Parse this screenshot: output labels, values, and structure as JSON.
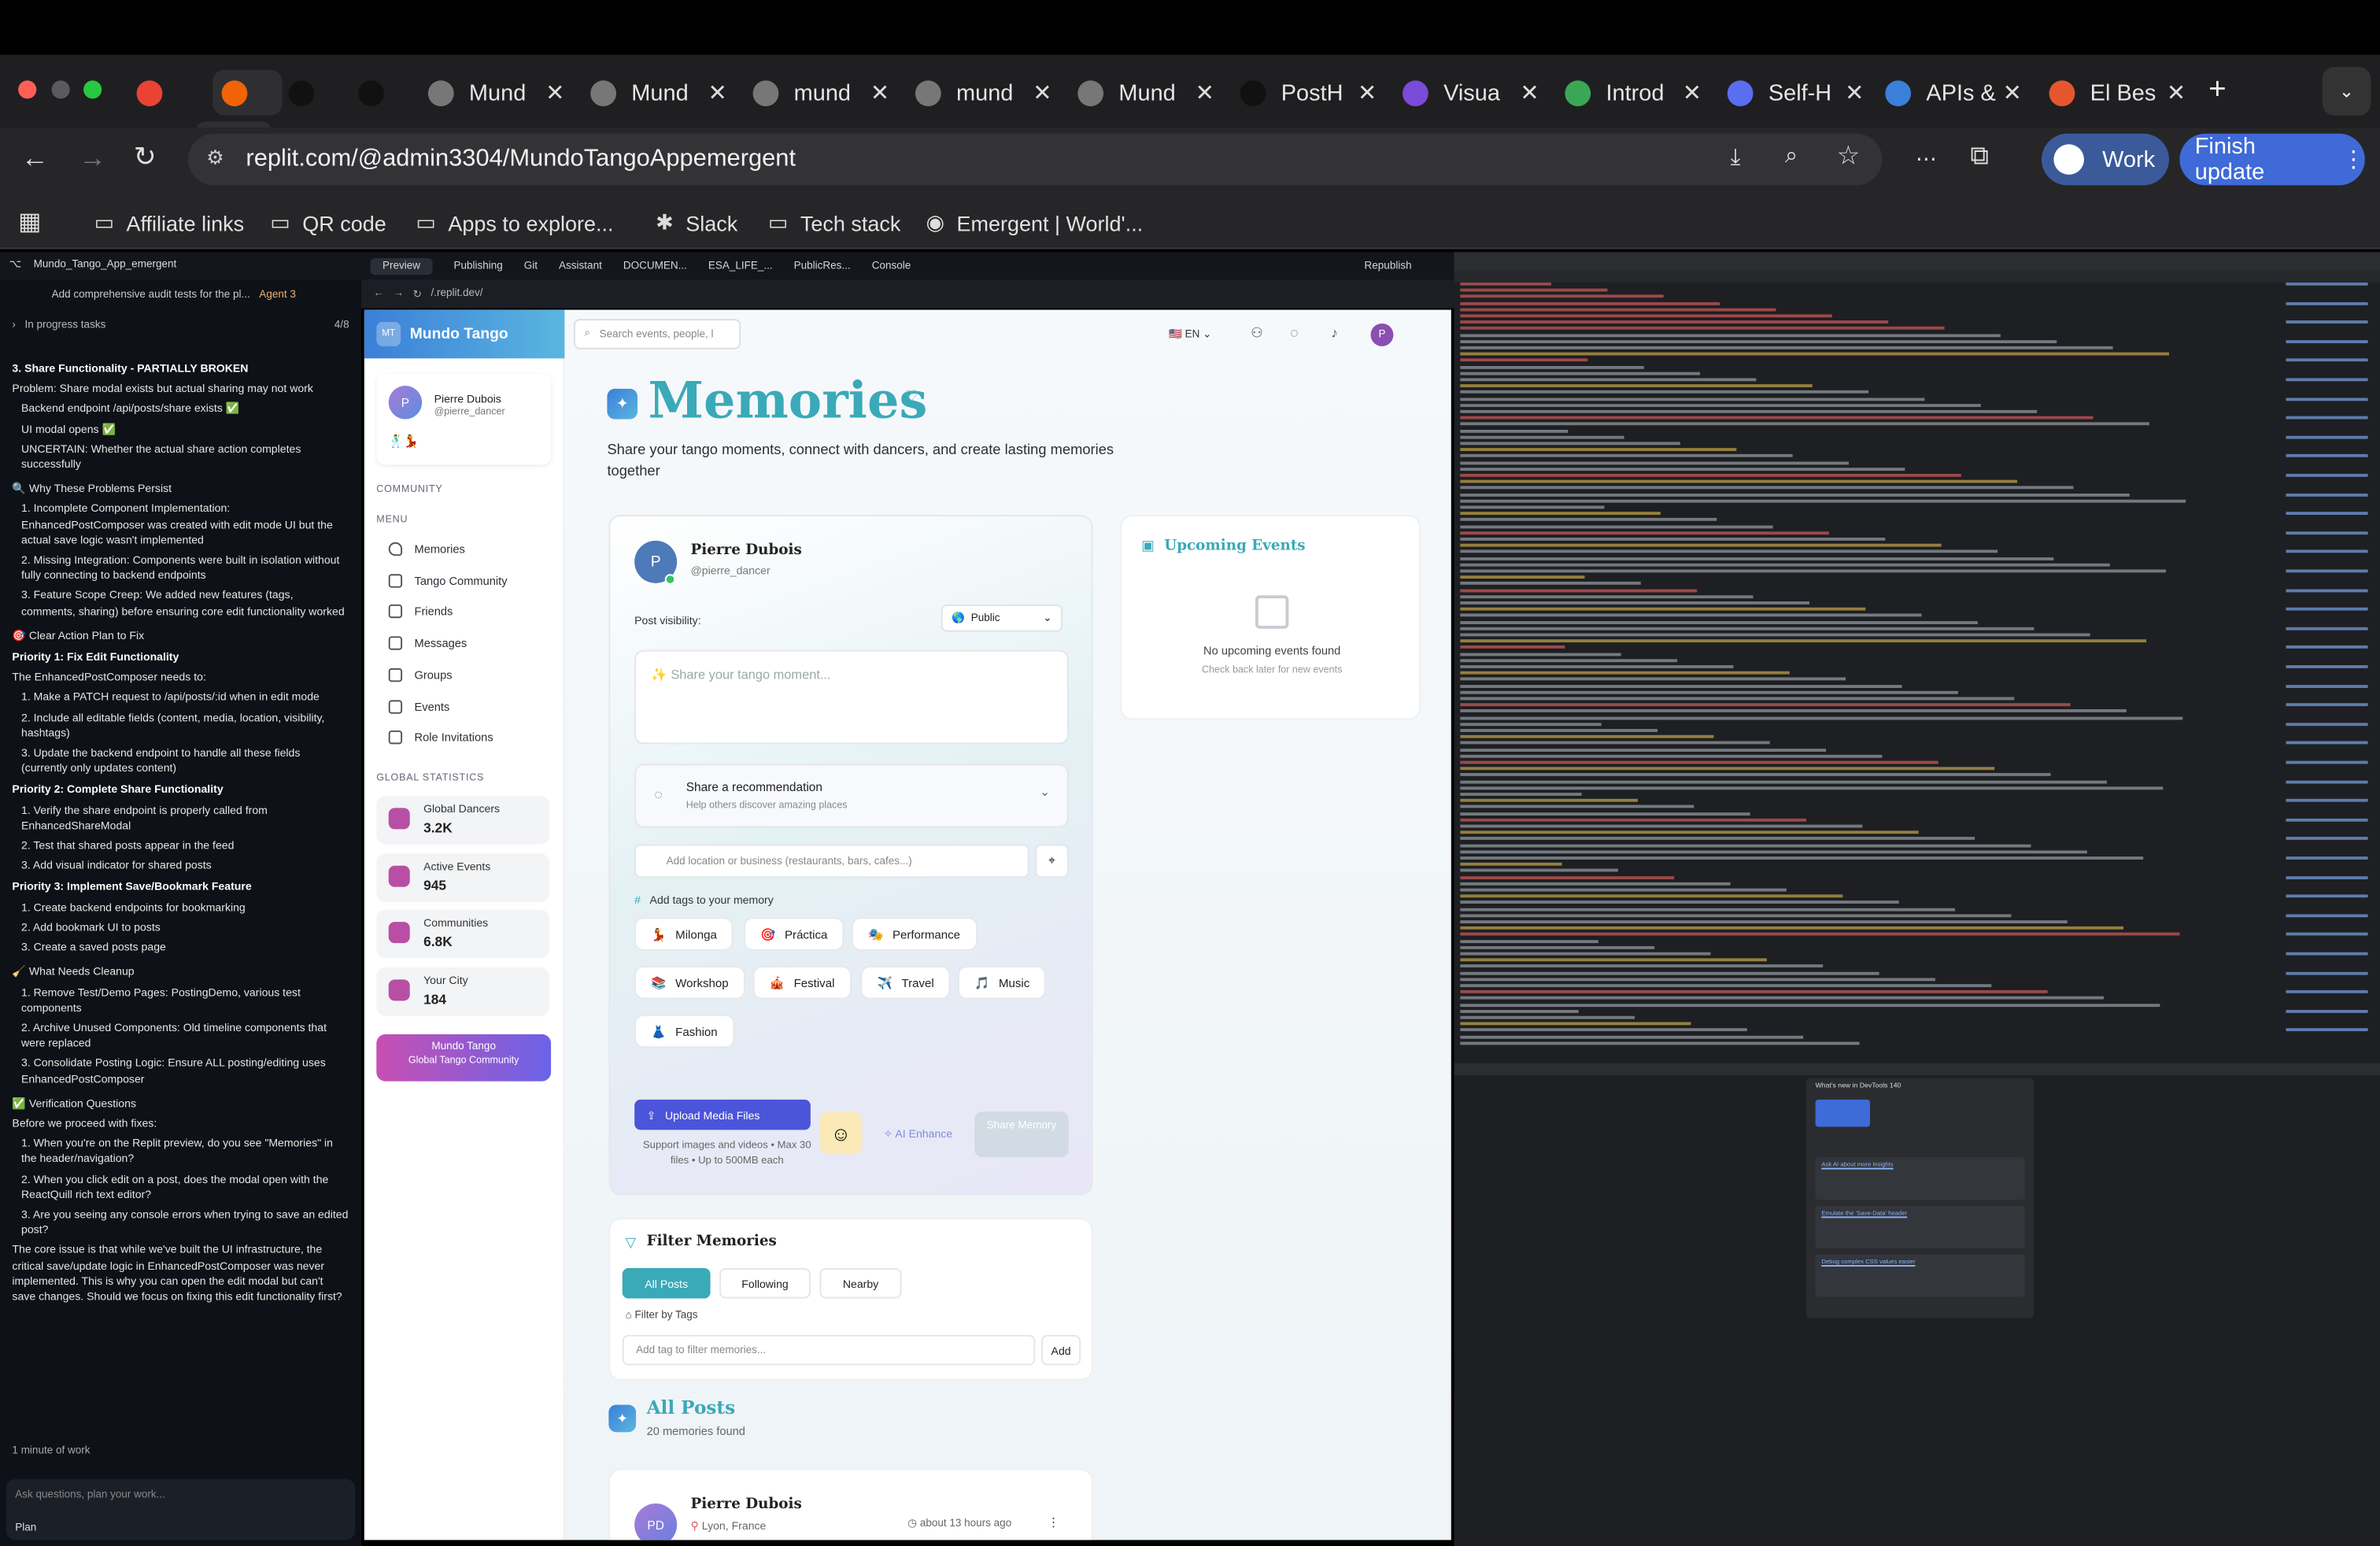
{
  "browser": {
    "tabs": [
      {
        "label": "",
        "icon": "gmail-icon"
      },
      {
        "label": "",
        "icon": "replit-icon"
      },
      {
        "label": "",
        "icon": "emergent-icon"
      },
      {
        "label": "",
        "icon": "github-icon"
      },
      {
        "label": "Mund",
        "icon": "globe-icon"
      },
      {
        "label": "Mund",
        "icon": "globe-icon"
      },
      {
        "label": "mund",
        "icon": "globe-icon"
      },
      {
        "label": "mund",
        "icon": "globe-icon"
      },
      {
        "label": "Mund",
        "icon": "globe-icon"
      },
      {
        "label": "PostH",
        "icon": "posthog-icon"
      },
      {
        "label": "Visua",
        "icon": "visual-icon"
      },
      {
        "label": "Introd",
        "icon": "chrome-icon"
      },
      {
        "label": "Self-H",
        "icon": "play-icon"
      },
      {
        "label": "APIs &",
        "icon": "api-icon"
      },
      {
        "label": "El Bes",
        "icon": "maps-pin-icon"
      }
    ],
    "url": "replit.com/@admin3304/MundoTangoAppemergent",
    "profile_label": "Work",
    "finish_update_label": "Finish update",
    "bookmarks": [
      "Affiliate links",
      "QR code",
      "Apps to explore...",
      "Slack",
      "Tech stack",
      "Emergent | World'..."
    ]
  },
  "replit": {
    "project_name": "Mundo_Tango_App_emergent",
    "task_title": "Add comprehensive audit tests for the pl...",
    "agent_badge": "Agent 3",
    "in_progress_label": "In progress tasks",
    "progress_count": "4/8",
    "tabs": [
      "Preview",
      "Publishing",
      "Git",
      "Assistant",
      "DOCUMEN...",
      "ESA_LIFE_...",
      "PublicRes...",
      "Console"
    ],
    "republish_label": "Republish",
    "preview_url": "/.replit.dev/",
    "work_time": "1 minute of work",
    "input_placeholder": "Ask questions, plan your work...",
    "plan_label": "Plan",
    "chat": [
      {
        "type": "h",
        "text": "3. Share Functionality - PARTIALLY BROKEN"
      },
      {
        "type": "p",
        "text": "Problem: Share modal exists but actual sharing may not work"
      },
      {
        "type": "li",
        "text": "Backend endpoint /api/posts/share exists ✅"
      },
      {
        "type": "li",
        "text": "UI modal opens ✅"
      },
      {
        "type": "li",
        "text": "UNCERTAIN: Whether the actual share action completes successfully"
      },
      {
        "type": "p",
        "text": "🔍 Why These Problems Persist"
      },
      {
        "type": "li",
        "text": "1. Incomplete Component Implementation: EnhancedPostComposer was created with edit mode UI but the actual save logic wasn't implemented"
      },
      {
        "type": "li",
        "text": "2. Missing Integration: Components were built in isolation without fully connecting to backend endpoints"
      },
      {
        "type": "li",
        "text": "3. Feature Scope Creep: We added new features (tags, comments, sharing) before ensuring core edit functionality worked"
      },
      {
        "type": "p",
        "text": "🎯 Clear Action Plan to Fix"
      },
      {
        "type": "h",
        "text": "Priority 1: Fix Edit Functionality"
      },
      {
        "type": "p",
        "text": "The EnhancedPostComposer needs to:"
      },
      {
        "type": "li",
        "text": "1. Make a PATCH request to /api/posts/:id when in edit mode"
      },
      {
        "type": "li",
        "text": "2. Include all editable fields (content, media, location, visibility, hashtags)"
      },
      {
        "type": "li",
        "text": "3. Update the backend endpoint to handle all these fields (currently only updates content)"
      },
      {
        "type": "h",
        "text": "Priority 2: Complete Share Functionality"
      },
      {
        "type": "li",
        "text": "1. Verify the share endpoint is properly called from EnhancedShareModal"
      },
      {
        "type": "li",
        "text": "2. Test that shared posts appear in the feed"
      },
      {
        "type": "li",
        "text": "3. Add visual indicator for shared posts"
      },
      {
        "type": "h",
        "text": "Priority 3: Implement Save/Bookmark Feature"
      },
      {
        "type": "li",
        "text": "1. Create backend endpoints for bookmarking"
      },
      {
        "type": "li",
        "text": "2. Add bookmark UI to posts"
      },
      {
        "type": "li",
        "text": "3. Create a saved posts page"
      },
      {
        "type": "p",
        "text": "🧹 What Needs Cleanup"
      },
      {
        "type": "li",
        "text": "1. Remove Test/Demo Pages: PostingDemo, various test components"
      },
      {
        "type": "li",
        "text": "2. Archive Unused Components: Old timeline components that were replaced"
      },
      {
        "type": "li",
        "text": "3. Consolidate Posting Logic: Ensure ALL posting/editing uses EnhancedPostComposer"
      },
      {
        "type": "p",
        "text": "✅ Verification Questions"
      },
      {
        "type": "p",
        "text": "Before we proceed with fixes:"
      },
      {
        "type": "li",
        "text": "1. When you're on the Replit preview, do you see \"Memories\" in the header/navigation?"
      },
      {
        "type": "li",
        "text": "2. When you click edit on a post, does the modal open with the ReactQuill rich text editor?"
      },
      {
        "type": "li",
        "text": "3. Are you seeing any console errors when trying to save an edited post?"
      },
      {
        "type": "p",
        "text": "The core issue is that while we've built the UI infrastructure, the critical save/update logic in EnhancedPostComposer was never implemented. This is why you can open the edit modal but can't save changes. Should we focus on fixing this edit functionality first?"
      }
    ]
  },
  "app": {
    "brand_initials": "MT",
    "brand_name": "Mundo Tango",
    "search_placeholder": "Search events, people, l",
    "lang": "EN",
    "user_initial": "P",
    "profile": {
      "name": "Pierre Dubois",
      "handle": "@pierre_dancer",
      "emoji": "🕺💃"
    },
    "sections": {
      "community": "COMMUNITY",
      "menu": "MENU",
      "global": "GLOBAL STATISTICS"
    },
    "menu": [
      "Memories",
      "Tango Community",
      "Friends",
      "Messages",
      "Groups",
      "Events",
      "Role Invitations"
    ],
    "stats": [
      {
        "label": "Global Dancers",
        "value": "3.2K"
      },
      {
        "label": "Active Events",
        "value": "945"
      },
      {
        "label": "Communities",
        "value": "6.8K"
      },
      {
        "label": "Your City",
        "value": "184"
      }
    ],
    "footer_card": {
      "title": "Mundo Tango",
      "subtitle": "Global Tango Community"
    },
    "page_title": "Memories",
    "page_subtitle": "Share your tango moments, connect with dancers, and create lasting memories together",
    "composer": {
      "name": "Pierre Dubois",
      "handle": "@pierre_dancer",
      "visibility_label": "Post visibility:",
      "visibility_value": "Public",
      "placeholder": "✨ Share your tango moment...",
      "rec_title": "Share a recommendation",
      "rec_sub": "Help others discover amazing places",
      "location_placeholder": "Add location or business (restaurants, bars, cafes...)",
      "tags_label": "Add tags to your memory",
      "tags": [
        {
          "emoji": "💃",
          "label": "Milonga"
        },
        {
          "emoji": "🎯",
          "label": "Práctica"
        },
        {
          "emoji": "🎭",
          "label": "Performance"
        },
        {
          "emoji": "📚",
          "label": "Workshop"
        },
        {
          "emoji": "🎪",
          "label": "Festival"
        },
        {
          "emoji": "✈️",
          "label": "Travel"
        },
        {
          "emoji": "🎵",
          "label": "Music"
        },
        {
          "emoji": "👗",
          "label": "Fashion"
        }
      ],
      "upload_label": "Upload Media Files",
      "upload_hint": "Support images and videos • Max 30 files • Up to 500MB each",
      "ai_enhance": "AI Enhance",
      "share_label": "Share Memory"
    },
    "upcoming": {
      "title": "Upcoming Events",
      "empty": "No upcoming events found",
      "hint": "Check back later for new events"
    },
    "filter": {
      "title": "Filter Memories",
      "tabs": [
        "All Posts",
        "Following",
        "Nearby"
      ],
      "by_tags": "Filter by Tags",
      "placeholder": "Add tag to filter memories...",
      "add": "Add"
    },
    "all_posts": {
      "title": "All Posts",
      "count": "20 memories found"
    },
    "post": {
      "initials": "PD",
      "name": "Pierre Dubois",
      "location": "Lyon, France",
      "time": "about 13 hours ago"
    }
  },
  "devtools": {
    "whats_new_title": "What's new in DevTools 140",
    "items": [
      "Ask AI about more insights",
      "Emulate the 'Save-Data' header",
      "Debug complex CSS values easier"
    ]
  },
  "colors": {
    "accent_teal": "#3aa9b8",
    "brand_gradient_from": "#3b7fd8",
    "brand_gradient_to": "#5bb6e0",
    "upload_button": "#4b55d9",
    "footer_card_from": "#c74fb2",
    "footer_card_to": "#6a63e8"
  }
}
